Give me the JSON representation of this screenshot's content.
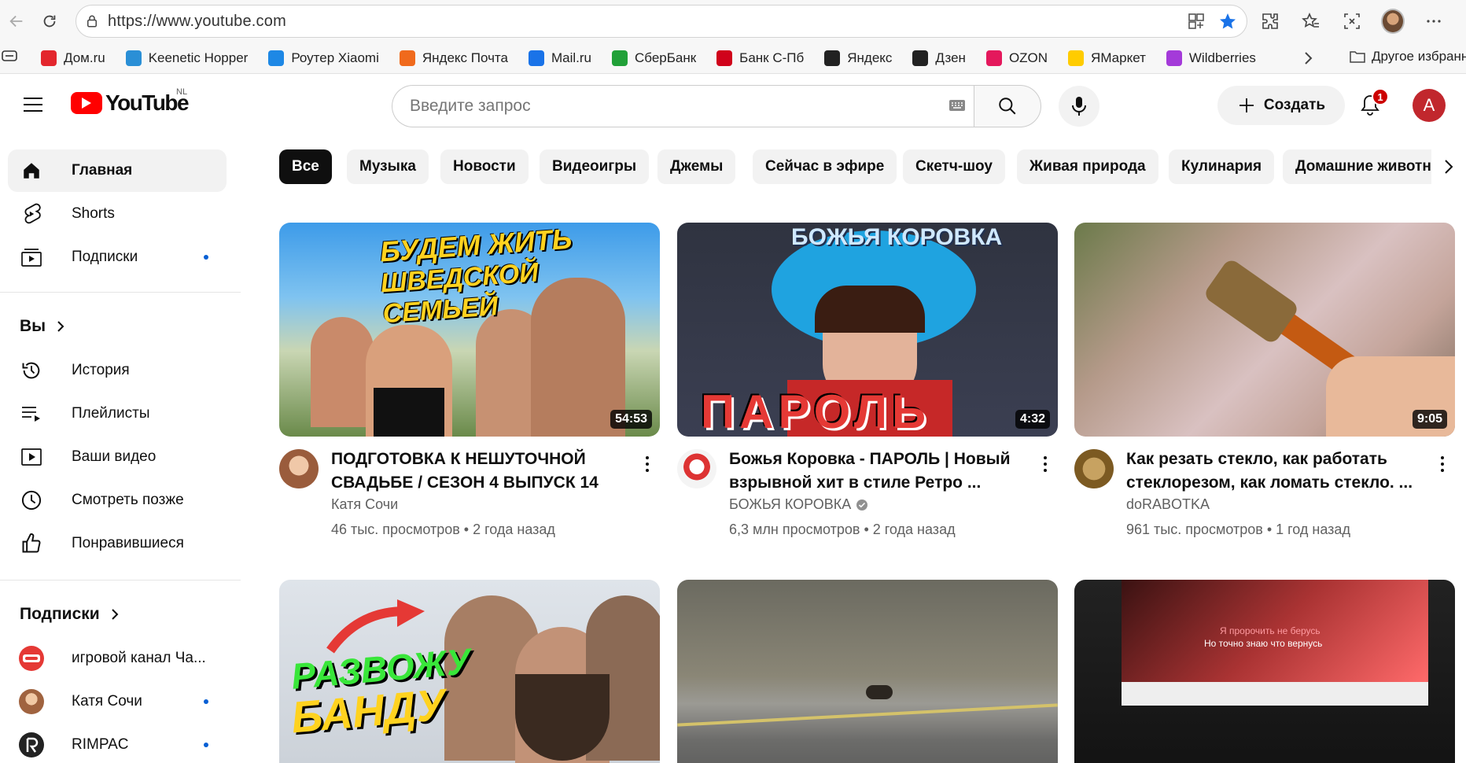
{
  "browser": {
    "url": "https://www.youtube.com",
    "bookmarks": [
      {
        "label": "Дом.ru",
        "icon": "domru-icon",
        "color": "#e3262d"
      },
      {
        "label": "Keenetic Hopper",
        "icon": "keenetic-icon",
        "color": "#2a8fd6"
      },
      {
        "label": "Роутер Xiaomi",
        "icon": "wifi-icon",
        "color": "#1e88e5"
      },
      {
        "label": "Яндекс Почта",
        "icon": "yandex-mail-icon",
        "color": "#f06a1c"
      },
      {
        "label": "Mail.ru",
        "icon": "mailru-icon",
        "color": "#1a73e8"
      },
      {
        "label": "СберБанк",
        "icon": "sber-icon",
        "color": "#21a038"
      },
      {
        "label": "Банк С-Пб",
        "icon": "bspb-icon",
        "color": "#d0021b"
      },
      {
        "label": "Яндекс",
        "icon": "yandex-icon",
        "color": "#222222"
      },
      {
        "label": "Дзен",
        "icon": "dzen-icon",
        "color": "#222222"
      },
      {
        "label": "OZON",
        "icon": "ozon-icon",
        "color": "#e4185c"
      },
      {
        "label": "ЯМаркет",
        "icon": "ymarket-icon",
        "color": "#ffcc00"
      },
      {
        "label": "Wildberries",
        "icon": "wb-icon",
        "color": "#a43ad9"
      }
    ],
    "other_bookmarks": "Другое избранное"
  },
  "header": {
    "logo_text": "YouTube",
    "country": "NL",
    "search_placeholder": "Введите запрос",
    "create_label": "Создать",
    "notifications_count": "1",
    "user_initial": "A",
    "brand_color": "#ff0000"
  },
  "sidebar": {
    "main": [
      {
        "label": "Главная",
        "icon": "home-icon"
      },
      {
        "label": "Shorts",
        "icon": "shorts-icon"
      },
      {
        "label": "Подписки",
        "icon": "subscriptions-icon"
      }
    ],
    "you_title": "Вы",
    "you_items": [
      {
        "label": "История",
        "icon": "history-icon"
      },
      {
        "label": "Плейлисты",
        "icon": "playlists-icon"
      },
      {
        "label": "Ваши видео",
        "icon": "your-videos-icon"
      },
      {
        "label": "Смотреть позже",
        "icon": "watch-later-icon"
      },
      {
        "label": "Понравившиеся",
        "icon": "liked-icon"
      }
    ],
    "subs_title": "Подписки",
    "subscriptions": [
      {
        "label": "игровой канал Ча...",
        "avatar_color": "#e53935"
      },
      {
        "label": "Катя Сочи",
        "avatar_color": "#b9805a"
      },
      {
        "label": "RIMPAC",
        "avatar_color": "#222222"
      }
    ]
  },
  "chips": [
    "Все",
    "Музыка",
    "Новости",
    "Видеоигры",
    "Джемы",
    "Сейчас в эфире",
    "Скетч-шоу",
    "Живая природа",
    "Кулинария",
    "Домашние животн"
  ],
  "videos": [
    {
      "title": "ПОДГОТОВКА К НЕШУТОЧНОЙ СВАДЬБЕ / СЕЗОН 4 ВЫПУСК 14",
      "channel": "Катя Сочи",
      "views": "46 тыс. просмотров",
      "age": "2 года назад",
      "duration": "54:53",
      "thumb_text_1": "БУДЕМ ЖИТЬ",
      "thumb_text_2": "ШВЕДСКОЙ СЕМЬЕЙ"
    },
    {
      "title": "Божья Коровка - ПАРОЛЬ | Новый взрывной хит в стиле Ретро ...",
      "channel": "БОЖЬЯ КОРОВКА",
      "views": "6,3 млн просмотров",
      "age": "2 года назад",
      "duration": "4:32",
      "thumb_text_1": "БОЖЬЯ КОРОВКА",
      "thumb_text_2": "ПАРОЛЬ"
    },
    {
      "title": "Как резать стекло, как работать стеклорезом, как ломать стекло. ...",
      "channel": "doRABOTKA",
      "views": "961 тыс. просмотров",
      "age": "1 год назад",
      "duration": "9:05"
    },
    {
      "thumb_text_1": "РАЗВОЖУ",
      "thumb_text_2": "БАНДУ"
    },
    {},
    {
      "thumb_text_1": "Я пророчить не берусь",
      "thumb_text_2": "Но точно знаю что вернусь"
    }
  ]
}
